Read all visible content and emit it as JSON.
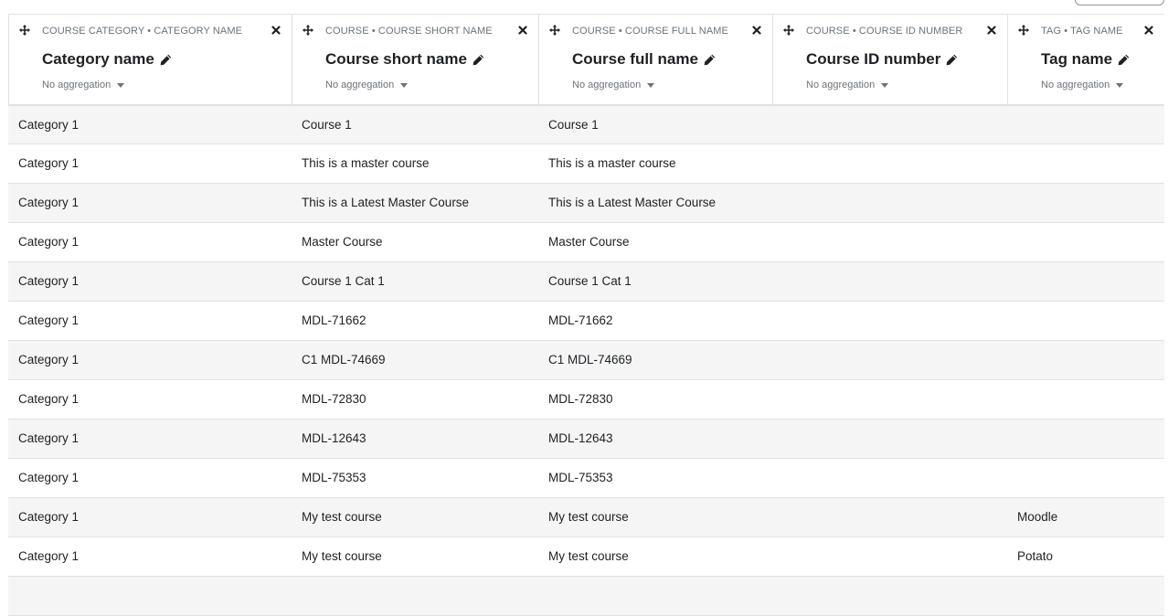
{
  "columns": [
    {
      "label": "COURSE CATEGORY • CATEGORY NAME",
      "title": "Category name",
      "aggregation": "No aggregation"
    },
    {
      "label": "COURSE • COURSE SHORT NAME",
      "title": "Course short name",
      "aggregation": "No aggregation"
    },
    {
      "label": "COURSE • COURSE FULL NAME",
      "title": "Course full name",
      "aggregation": "No aggregation"
    },
    {
      "label": "COURSE • COURSE ID NUMBER",
      "title": "Course ID number",
      "aggregation": "No aggregation"
    },
    {
      "label": "TAG • TAG NAME",
      "title": "Tag name",
      "aggregation": "No aggregation"
    }
  ],
  "rows": [
    [
      "Category 1",
      "Course 1",
      "Course 1",
      "",
      ""
    ],
    [
      "Category 1",
      "This is a master course",
      "This is a master course",
      "",
      ""
    ],
    [
      "Category 1",
      "This is a Latest Master Course",
      "This is a Latest Master Course",
      "",
      ""
    ],
    [
      "Category 1",
      "Master Course",
      "Master Course",
      "",
      ""
    ],
    [
      "Category 1",
      "Course 1 Cat 1",
      "Course 1 Cat 1",
      "",
      ""
    ],
    [
      "Category 1",
      "MDL-71662",
      "MDL-71662",
      "",
      ""
    ],
    [
      "Category 1",
      "C1 MDL-74669",
      "C1 MDL-74669",
      "",
      ""
    ],
    [
      "Category 1",
      "MDL-72830",
      "MDL-72830",
      "",
      ""
    ],
    [
      "Category 1",
      "MDL-12643",
      "MDL-12643",
      "",
      ""
    ],
    [
      "Category 1",
      "MDL-75353",
      "MDL-75353",
      "",
      ""
    ],
    [
      "Category 1",
      "My test course",
      "My test course",
      "",
      "Moodle"
    ],
    [
      "Category 1",
      "My test course",
      "My test course",
      "",
      "Potato"
    ],
    [
      "",
      "",
      "",
      "",
      ""
    ]
  ],
  "colors": {
    "stripe": "#f5f5f5",
    "border": "#dee2e6",
    "muted": "#6a737b",
    "text": "#1d2125"
  },
  "icons": {
    "move": "move-icon",
    "close": "close-icon",
    "edit": "pencil-icon",
    "dropdown": "caret-down-icon"
  }
}
